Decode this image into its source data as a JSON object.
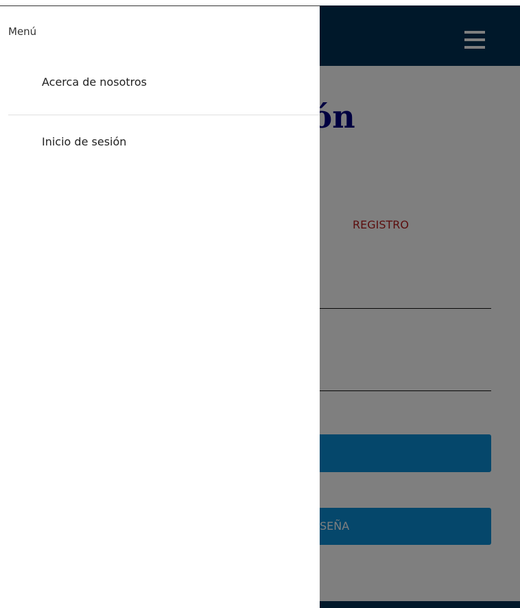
{
  "drawer": {
    "title": "Menú",
    "items": [
      {
        "label": "Acerca de nosotros"
      },
      {
        "label": "Inicio de sesión"
      }
    ]
  },
  "app": {
    "heading_visible": "sesión",
    "tab_registro": "REGISTRO",
    "secondary_button_visible": "SEÑA",
    "menu_icon": "hamburger-menu-icon"
  },
  "colors": {
    "topbar": "#003054",
    "heading": "#000080",
    "button": "#0a8fd6",
    "registro_tab": "#b71c1c"
  }
}
